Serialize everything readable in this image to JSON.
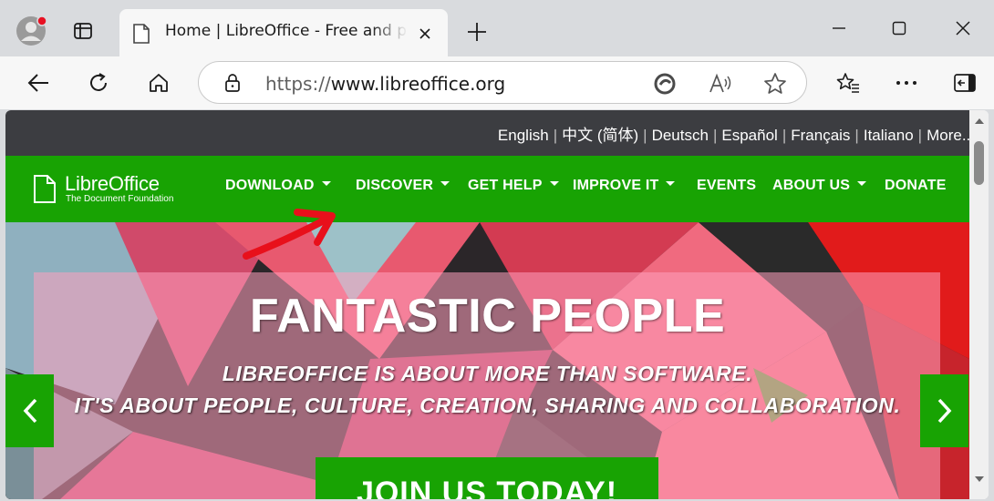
{
  "browser": {
    "tab_title": "Home | LibreOffice - Free and private office suite",
    "url_prefix": "https://",
    "url_host": "www.libreoffice.org"
  },
  "site": {
    "languages": [
      "English",
      "中文 (简体)",
      "Deutsch",
      "Español",
      "Français",
      "Italiano",
      "More..."
    ],
    "logo": {
      "name": "LibreOffice",
      "tagline": "The Document Foundation"
    },
    "nav": {
      "download": "DOWNLOAD",
      "discover": "DISCOVER",
      "get_help": "GET HELP",
      "improve_it": "IMPROVE IT",
      "events": "EVENTS",
      "about_us": "ABOUT US",
      "donate": "DONATE"
    },
    "hero": {
      "headline": "FANTASTIC PEOPLE",
      "line1": "LIBREOFFICE IS ABOUT MORE THAN SOFTWARE.",
      "line2": "IT'S ABOUT PEOPLE, CULTURE, CREATION, SHARING AND COLLABORATION.",
      "cta": "JOIN US TODAY!"
    }
  },
  "colors": {
    "brand_green": "#18a303",
    "lang_bar": "#3c3d41",
    "annotation_red": "#e8101b"
  }
}
